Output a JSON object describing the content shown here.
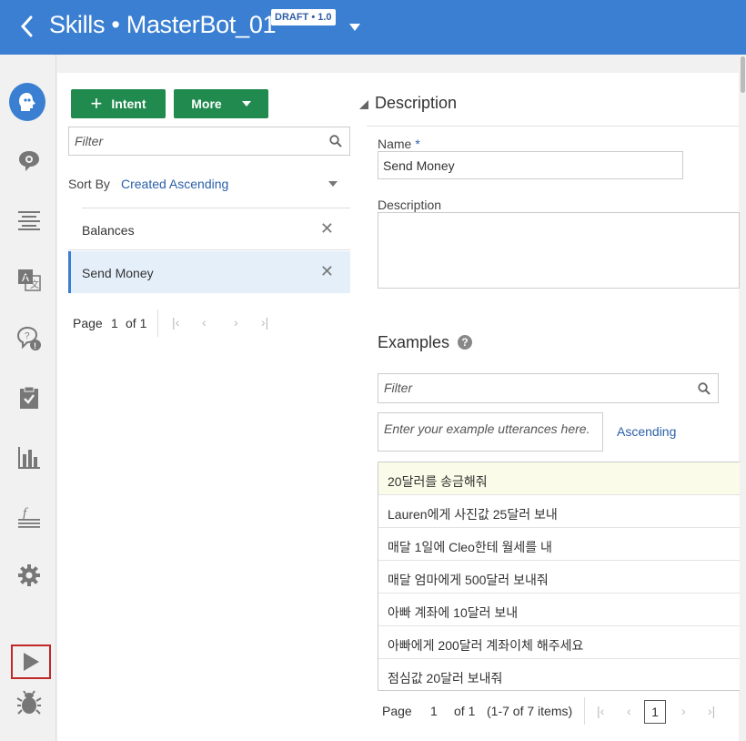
{
  "header": {
    "title": "Skills • MasterBot_01",
    "badge": "DRAFT • 1.0"
  },
  "colors": {
    "header_bg": "#3a7fd1",
    "primary_button": "#208a4f",
    "link": "#2a5fa8",
    "selected_row": "#e4effa",
    "highlight_row": "#fafbe8"
  },
  "rail": {
    "items": [
      {
        "icon": "bot-head-icon"
      },
      {
        "icon": "chat-bubble-gear-icon"
      },
      {
        "icon": "entities-list-icon"
      },
      {
        "icon": "translate-icon"
      },
      {
        "icon": "question-bubble-icon"
      },
      {
        "icon": "clipboard-check-icon"
      },
      {
        "icon": "bar-chart-icon"
      },
      {
        "icon": "function-icon"
      },
      {
        "icon": "gear-icon"
      },
      {
        "icon": "play-icon"
      },
      {
        "icon": "bug-icon"
      }
    ]
  },
  "intents": {
    "add_button": "Intent",
    "more_button": "More",
    "filter_placeholder": "Filter",
    "sort_label": "Sort By",
    "sort_value": "Created Ascending",
    "items": [
      {
        "label": "Balances"
      },
      {
        "label": "Send Money"
      }
    ],
    "pager": {
      "page_label": "Page",
      "page": "1",
      "of": "of 1"
    }
  },
  "description": {
    "section_title": "Description",
    "name_label": "Name",
    "name_required": "*",
    "name_value": "Send Money",
    "description_label": "Description"
  },
  "examples": {
    "title": "Examples",
    "help": "?",
    "filter_placeholder": "Filter",
    "utterance_placeholder": "Enter your example utterances here.",
    "sort_toggle": "Ascending",
    "rows": [
      "20달러를 송금해줘",
      "Lauren에게 사진값 25달러 보내",
      "매달 1일에 Cleo한테 월세를 내",
      "매달 엄마에게 500달러 보내줘",
      "아빠 계좌에 10달러 보내",
      "아빠에게 200달러 계좌이체 해주세요",
      "점심값 20달러 보내줘"
    ],
    "pager": {
      "page_label": "Page",
      "page": "1",
      "of": "of 1",
      "range": "(1-7 of 7 items)",
      "current": "1"
    }
  }
}
